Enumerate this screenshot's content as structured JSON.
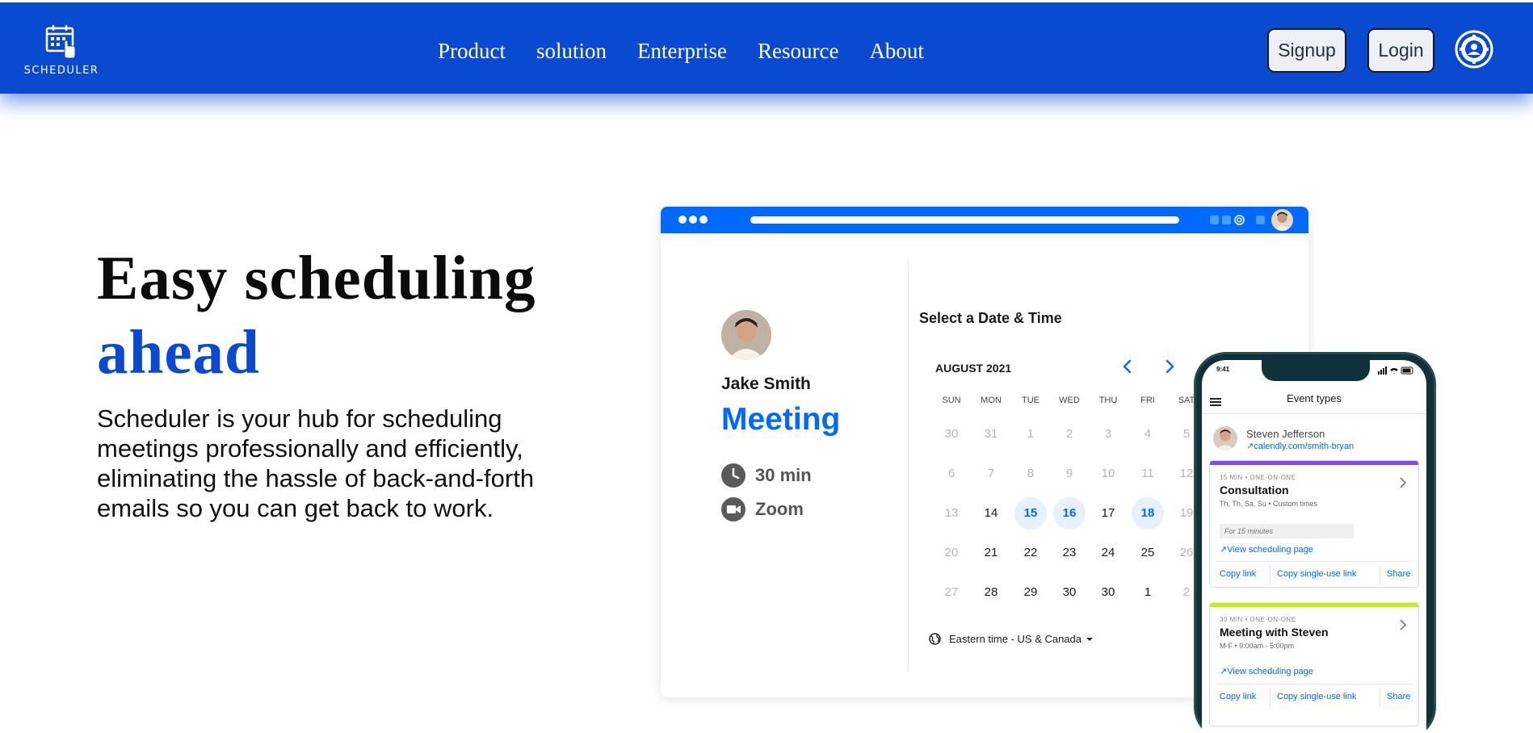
{
  "navbar": {
    "logo_text": "SCHEDULER",
    "links": [
      "Product",
      "solution",
      "Enterprise",
      "Resource",
      "About"
    ],
    "signup_label": "Signup",
    "login_label": "Login",
    "background": "#0a4ad1"
  },
  "hero": {
    "title_line1": "Easy scheduling",
    "title_line2": "ahead",
    "description": "Scheduler is your hub for scheduling meetings professionally and efficiently, eliminating the hassle of back-and-forth emails so you can get back to work."
  },
  "browser_mockup": {
    "host_name": "Jake Smith",
    "event_name": "Meeting",
    "duration": "30 min",
    "location": "Zoom",
    "select_title": "Select a Date & Time",
    "month": "AUGUST 2021",
    "weekdays": [
      "SUN",
      "MON",
      "TUE",
      "WED",
      "THU",
      "FRI",
      "SAT"
    ],
    "weeks": [
      [
        {
          "d": "30",
          "s": "muted"
        },
        {
          "d": "31",
          "s": "muted"
        },
        {
          "d": "1",
          "s": "muted"
        },
        {
          "d": "2",
          "s": "muted"
        },
        {
          "d": "3",
          "s": "muted"
        },
        {
          "d": "4",
          "s": "muted"
        },
        {
          "d": "5",
          "s": "muted"
        }
      ],
      [
        {
          "d": "6",
          "s": "muted"
        },
        {
          "d": "7",
          "s": "muted"
        },
        {
          "d": "8",
          "s": "muted"
        },
        {
          "d": "9",
          "s": "muted"
        },
        {
          "d": "10",
          "s": "muted"
        },
        {
          "d": "11",
          "s": "muted"
        },
        {
          "d": "12",
          "s": "muted"
        }
      ],
      [
        {
          "d": "13",
          "s": "muted"
        },
        {
          "d": "14",
          "s": "normal"
        },
        {
          "d": "15",
          "s": "avail"
        },
        {
          "d": "16",
          "s": "avail"
        },
        {
          "d": "17",
          "s": "normal"
        },
        {
          "d": "18",
          "s": "avail"
        },
        {
          "d": "19",
          "s": "muted"
        }
      ],
      [
        {
          "d": "20",
          "s": "muted"
        },
        {
          "d": "21",
          "s": "normal"
        },
        {
          "d": "22",
          "s": "normal"
        },
        {
          "d": "23",
          "s": "normal"
        },
        {
          "d": "24",
          "s": "normal"
        },
        {
          "d": "25",
          "s": "normal"
        },
        {
          "d": "26",
          "s": "muted"
        }
      ],
      [
        {
          "d": "27",
          "s": "muted"
        },
        {
          "d": "28",
          "s": "normal"
        },
        {
          "d": "29",
          "s": "normal"
        },
        {
          "d": "30",
          "s": "normal"
        },
        {
          "d": "30",
          "s": "normal"
        },
        {
          "d": "1",
          "s": "normal"
        },
        {
          "d": "2",
          "s": "muted"
        }
      ]
    ],
    "timezone": "Eastern time - US & Canada",
    "accent": "#0069ff"
  },
  "phone_mockup": {
    "time": "9:41",
    "title": "Event types",
    "user_name": "Steven Jefferson",
    "user_link": "calendly.com/smith-bryan",
    "cards": [
      {
        "kicker": "15 MIN • ONE-ON-ONE",
        "title": "Consultation",
        "subtitle": "Th, Th, Sa, Su • Custom times",
        "note": "For 15 minutes",
        "view_link": "View scheduling page",
        "actions": [
          "Copy link",
          "Copy single-use link",
          "Share"
        ],
        "color": "#8247f5"
      },
      {
        "kicker": "30 MIN • ONE-ON-ONE",
        "title": "Meeting with Steven",
        "subtitle": "M-F • 9:00am - 5:00pm",
        "note": "",
        "view_link": "View scheduling page",
        "actions": [
          "Copy link",
          "Copy single-use link",
          "Share"
        ],
        "color": "#c6f014"
      }
    ]
  }
}
